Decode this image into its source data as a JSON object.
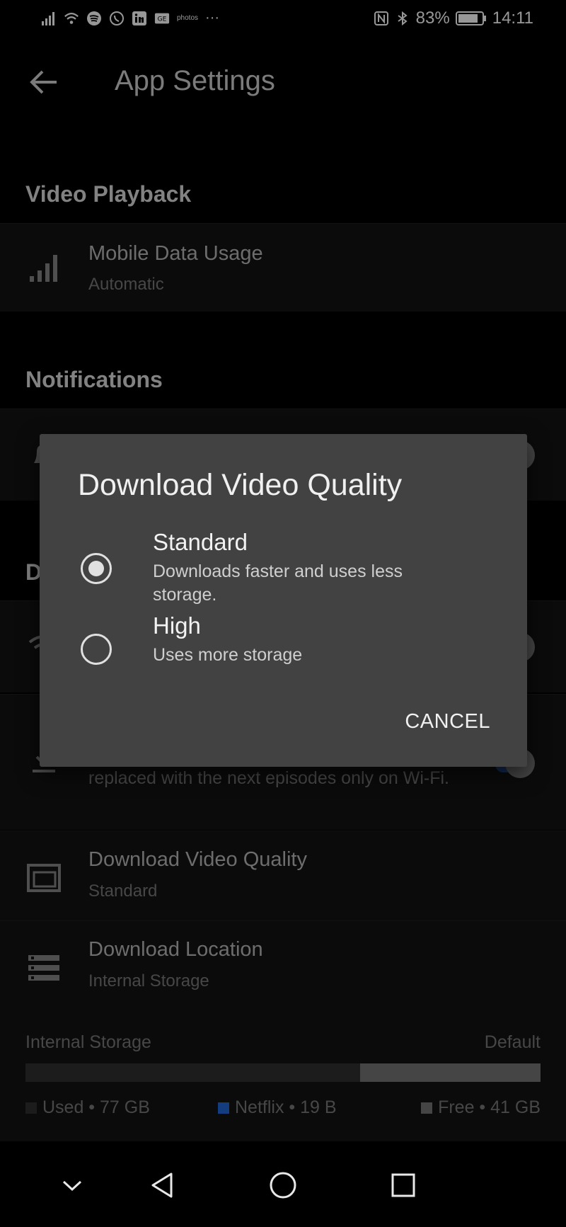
{
  "status_bar": {
    "battery": "83%",
    "time": "14:11",
    "left_icons": [
      "signal-icon",
      "wifi-icon",
      "spotify-icon",
      "whatsapp-icon",
      "linkedin-icon",
      "ge-icon",
      "photos-icon",
      "more-icon"
    ],
    "right_icons": [
      "nfc-icon",
      "bluetooth-icon",
      "battery-icon"
    ],
    "photos_text": "photos",
    "ge_text": "GE",
    "more_text": "···"
  },
  "app_bar": {
    "title": "App Settings"
  },
  "sections": {
    "video_playback": "Video Playback",
    "notifications": "Notifications",
    "downloads_partial": "D"
  },
  "rows": {
    "mobile_data": {
      "title": "Mobile Data Usage",
      "value": "Automatic"
    },
    "smart_downloads_partial": {
      "text": "replaced with the next episodes only on Wi-Fi."
    },
    "download_quality": {
      "title": "Download Video Quality",
      "value": "Standard"
    },
    "download_location": {
      "title": "Download Location",
      "value": "Internal Storage"
    }
  },
  "storage": {
    "label": "Internal Storage",
    "default_label": "Default",
    "used_fraction": 0.65,
    "legend": {
      "used": "Used • 77 GB",
      "netflix": "Netflix • 19 B",
      "free": "Free • 41 GB"
    },
    "colors": {
      "used": "#2b2b2b",
      "netflix": "#1f5fc4",
      "free": "#6b6b6b"
    }
  },
  "dialog": {
    "title": "Download Video Quality",
    "options": [
      {
        "label": "Standard",
        "description": "Downloads faster and uses less storage.",
        "selected": true
      },
      {
        "label": "High",
        "description": "Uses more storage",
        "selected": false
      }
    ],
    "cancel": "CANCEL"
  },
  "navbar": {
    "icons": [
      "chevron-down-icon",
      "back-triangle-icon",
      "home-circle-icon",
      "recents-square-icon"
    ]
  }
}
